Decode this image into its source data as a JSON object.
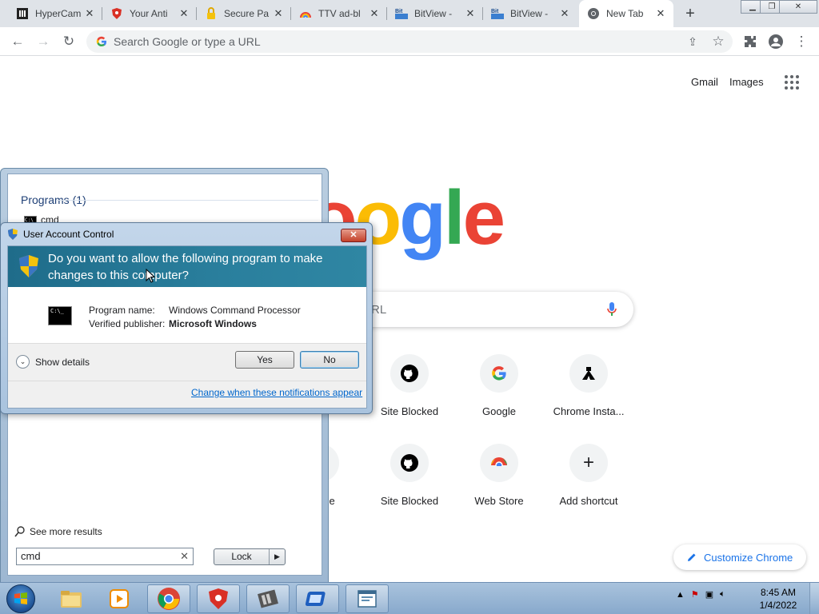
{
  "browser": {
    "tabs": [
      {
        "title": "HyperCam",
        "icon": "hypercam-icon"
      },
      {
        "title": "Your Anti",
        "icon": "shield-icon"
      },
      {
        "title": "Secure Pa",
        "icon": "padlock-icon"
      },
      {
        "title": "TTV ad-bl",
        "icon": "rainbow-icon"
      },
      {
        "title": "BitView - ",
        "icon": "bitview-icon"
      },
      {
        "title": "BitView - ",
        "icon": "bitview-icon"
      },
      {
        "title": "New Tab",
        "icon": "chrome-icon"
      }
    ],
    "omnibox_placeholder": "Search Google or type a URL"
  },
  "ntp": {
    "gmail": "Gmail",
    "images": "Images",
    "logo_visible": "oogle",
    "search_placeholder_visible": "RL",
    "shortcuts_row1": [
      {
        "label": "Site Blocked",
        "icon": "github-icon"
      },
      {
        "label": "Google",
        "icon": "google-icon"
      },
      {
        "label": "Chrome Insta...",
        "icon": "hat-icon"
      }
    ],
    "shortcuts_row2": [
      {
        "label": "Frame",
        "icon": "frame-icon"
      },
      {
        "label": "Site Blocked",
        "icon": "github-icon"
      },
      {
        "label": "Web Store",
        "icon": "webstore-icon"
      },
      {
        "label": "Add shortcut",
        "icon": "plus-icon"
      }
    ],
    "customize": "Customize Chrome"
  },
  "start_menu": {
    "programs_header": "Programs (1)",
    "program": "cmd",
    "see_more": "See more results",
    "search_value": "cmd",
    "lock_label": "Lock"
  },
  "uac": {
    "title": "User Account Control",
    "question": "Do you want to allow the following program to make changes to this computer?",
    "program_name_label": "Program name:",
    "program_name": "Windows Command Processor",
    "publisher_label": "Verified publisher:",
    "publisher": "Microsoft Windows",
    "show_details": "Show details",
    "yes": "Yes",
    "no": "No",
    "change_link": "Change when these notifications appear",
    "cmd_icon_text": "C:\\_"
  },
  "taskbar": {
    "time": "8:45 AM",
    "date": "1/4/2022"
  },
  "colors": {
    "google_blue": "#4285f4",
    "google_red": "#ea4335",
    "google_yellow": "#fbbc05",
    "google_green": "#34a853",
    "uac_banner": "#1f6c8a",
    "link_blue": "#0066cc"
  }
}
